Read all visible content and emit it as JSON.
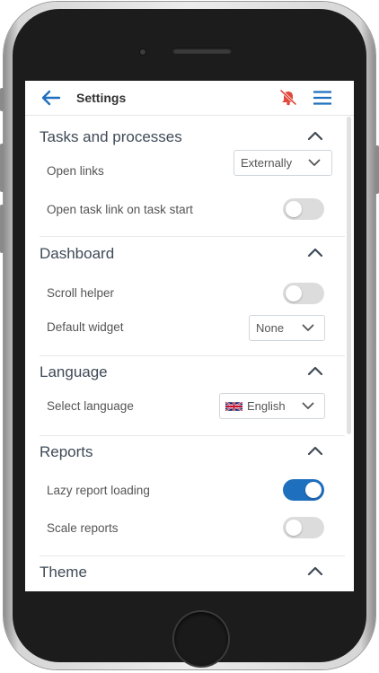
{
  "header": {
    "title": "Settings",
    "back_icon": "arrow-left-icon",
    "notifications_icon": "bell-off-icon",
    "menu_icon": "hamburger-menu-icon"
  },
  "colors": {
    "accent": "#1f6fbf",
    "alert": "#e0483b",
    "section_title": "#3f4a57",
    "label": "#555555",
    "toggle_off": "#dcdcdc",
    "toggle_on": "#1f6fbf"
  },
  "sections": {
    "tasks": {
      "title": "Tasks and processes",
      "expanded": true,
      "open_links": {
        "label": "Open links",
        "value": "Externally"
      },
      "open_task_link": {
        "label": "Open task link on task start",
        "enabled": false
      }
    },
    "dashboard": {
      "title": "Dashboard",
      "expanded": true,
      "scroll_helper": {
        "label": "Scroll helper",
        "enabled": false
      },
      "default_widget": {
        "label": "Default widget",
        "value": "None"
      }
    },
    "language": {
      "title": "Language",
      "expanded": true,
      "select_language": {
        "label": "Select language",
        "value": "English",
        "flag_icon": "uk-flag-icon"
      }
    },
    "reports": {
      "title": "Reports",
      "expanded": true,
      "lazy_loading": {
        "label": "Lazy report loading",
        "enabled": true
      },
      "scale_reports": {
        "label": "Scale reports",
        "enabled": false
      }
    },
    "theme": {
      "title": "Theme",
      "expanded": true
    }
  }
}
